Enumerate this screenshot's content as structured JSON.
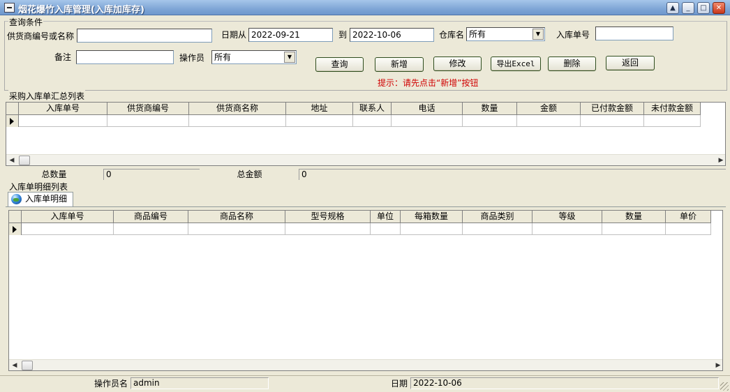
{
  "window": {
    "title": "烟花爆竹入库管理(入库加库存)"
  },
  "query": {
    "group_label": "查询条件",
    "supplier_label": "供货商编号或名称",
    "supplier_value": "",
    "date_from_label": "日期从",
    "date_from": "2022-09-21",
    "date_to_label": "到",
    "date_to": "2022-10-06",
    "warehouse_label": "仓库名",
    "warehouse_value": "所有",
    "receipt_no_label": "入库单号",
    "receipt_no_value": "",
    "remark_label": "备注",
    "remark_value": "",
    "operator_label": "操作员",
    "operator_value": "所有",
    "buttons": {
      "query": "查询",
      "add": "新增",
      "edit": "修改",
      "export": "导出Excel",
      "delete": "删除",
      "back": "返回"
    },
    "hint": "提示：请先点击“新增”按钮"
  },
  "summary": {
    "group_label": "采购入库单汇总列表",
    "columns": [
      "入库单号",
      "供货商编号",
      "供货商名称",
      "地址",
      "联系人",
      "电话",
      "数量",
      "金额",
      "已付款金额",
      "未付款金额"
    ],
    "total_qty_label": "总数量",
    "total_qty": "0",
    "total_amount_label": "总金额",
    "total_amount": "0"
  },
  "detail": {
    "group_label": "入库单明细列表",
    "tab_label": "入库单明细",
    "columns": [
      "入库单号",
      "商品编号",
      "商品名称",
      "型号规格",
      "单位",
      "每箱数量",
      "商品类别",
      "等级",
      "数量",
      "单价"
    ]
  },
  "status": {
    "operator_label": "操作员名",
    "operator": "admin",
    "date_label": "日期",
    "date": "2022-10-06"
  }
}
